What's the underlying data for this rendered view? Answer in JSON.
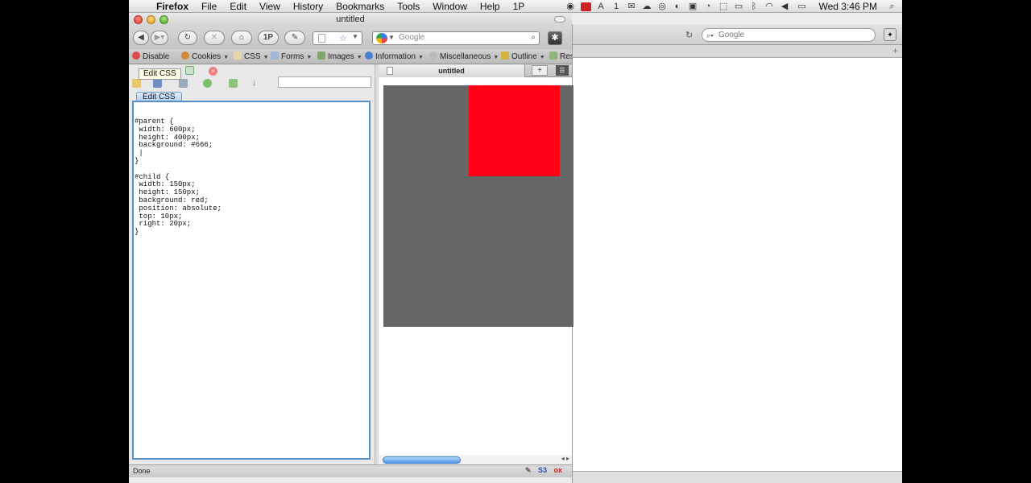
{
  "menubar": {
    "app_name": "Firefox",
    "items": [
      "File",
      "Edit",
      "View",
      "History",
      "Bookmarks",
      "Tools",
      "Window",
      "Help",
      "1P"
    ],
    "badge_count": "1",
    "clock": "Wed 3:46 PM"
  },
  "window": {
    "title": "untitled"
  },
  "navbar": {
    "onepassword_label": "1P",
    "search_placeholder": "Google"
  },
  "devbar": {
    "items": [
      "Disable",
      "Cookies",
      "CSS",
      "Forms",
      "Images",
      "Information",
      "Miscellaneous",
      "Outline",
      "Res"
    ]
  },
  "editor": {
    "tooltip": "Edit CSS",
    "tab_label": "Edit CSS",
    "css_code": "#parent {\n width: 600px;\n height: 400px;\n background: #666;\n |\n}\n\n#child {\n width: 150px;\n height: 150px;\n background: red;\n position: absolute;\n top: 10px;\n right: 20px;\n}"
  },
  "content": {
    "tab_title": "untitled",
    "new_tab_label": "+",
    "parent_color": "#666666",
    "child_color": "#ff0015"
  },
  "background_window": {
    "search_placeholder": "Google"
  },
  "statusbar": {
    "text": "Done",
    "icons": [
      "S3",
      "ox"
    ]
  }
}
